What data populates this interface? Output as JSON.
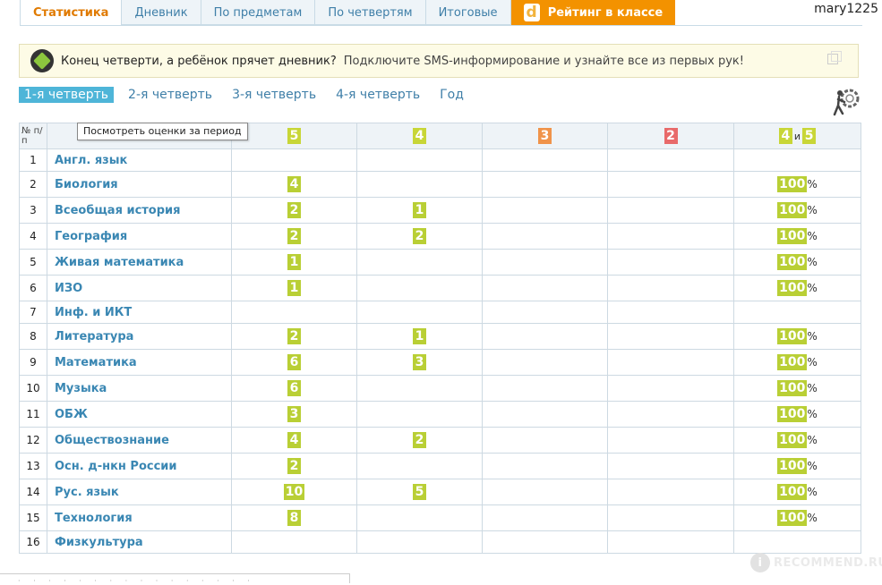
{
  "tabs": [
    {
      "label": "Статистика",
      "active": true
    },
    {
      "label": "Дневник"
    },
    {
      "label": "По предметам"
    },
    {
      "label": "По четвертям"
    },
    {
      "label": "Итоговые"
    },
    {
      "label": "Рейтинг в классе",
      "logo": "d"
    }
  ],
  "user": {
    "name": "mary1225"
  },
  "banner": {
    "strong": "Конец четверти, а ребёнок прячет дневник?",
    "text": "Подключите SMS-информирование и узнайте все из первых рук!"
  },
  "periods": [
    "1-я четверть",
    "2-я четверть",
    "3-я четверть",
    "4-я четверть",
    "Год"
  ],
  "active_period": 0,
  "tooltip": "Посмотреть оценки за период",
  "table": {
    "num_header": "№ п/п",
    "grade_headers": [
      "5",
      "4",
      "3",
      "2"
    ],
    "combo_header": {
      "a": "4",
      "and": "и",
      "b": "5"
    },
    "rows": [
      {
        "n": "1",
        "subject": "Англ. язык",
        "g5": "",
        "g4": "",
        "g3": "",
        "g2": "",
        "pct": ""
      },
      {
        "n": "2",
        "subject": "Биология",
        "g5": "4",
        "g4": "",
        "g3": "",
        "g2": "",
        "pct": "100"
      },
      {
        "n": "3",
        "subject": "Всеобщая история",
        "g5": "2",
        "g4": "1",
        "g3": "",
        "g2": "",
        "pct": "100"
      },
      {
        "n": "4",
        "subject": "География",
        "g5": "2",
        "g4": "2",
        "g3": "",
        "g2": "",
        "pct": "100"
      },
      {
        "n": "5",
        "subject": "Живая математика",
        "g5": "1",
        "g4": "",
        "g3": "",
        "g2": "",
        "pct": "100"
      },
      {
        "n": "6",
        "subject": "ИЗО",
        "g5": "1",
        "g4": "",
        "g3": "",
        "g2": "",
        "pct": "100"
      },
      {
        "n": "7",
        "subject": "Инф. и ИКТ",
        "g5": "",
        "g4": "",
        "g3": "",
        "g2": "",
        "pct": ""
      },
      {
        "n": "8",
        "subject": "Литература",
        "g5": "2",
        "g4": "1",
        "g3": "",
        "g2": "",
        "pct": "100"
      },
      {
        "n": "9",
        "subject": "Математика",
        "g5": "6",
        "g4": "3",
        "g3": "",
        "g2": "",
        "pct": "100"
      },
      {
        "n": "10",
        "subject": "Музыка",
        "g5": "6",
        "g4": "",
        "g3": "",
        "g2": "",
        "pct": "100"
      },
      {
        "n": "11",
        "subject": "ОБЖ",
        "g5": "3",
        "g4": "",
        "g3": "",
        "g2": "",
        "pct": "100"
      },
      {
        "n": "12",
        "subject": "Обществознание",
        "g5": "4",
        "g4": "2",
        "g3": "",
        "g2": "",
        "pct": "100"
      },
      {
        "n": "13",
        "subject": "Осн. д-нкн России",
        "g5": "2",
        "g4": "",
        "g3": "",
        "g2": "",
        "pct": "100"
      },
      {
        "n": "14",
        "subject": "Рус. язык",
        "g5": "10",
        "g4": "5",
        "g3": "",
        "g2": "",
        "pct": "100"
      },
      {
        "n": "15",
        "subject": "Технология",
        "g5": "8",
        "g4": "",
        "g3": "",
        "g2": "",
        "pct": "100"
      },
      {
        "n": "16",
        "subject": "Физкультура",
        "g5": "",
        "g4": "",
        "g3": "",
        "g2": "",
        "pct": ""
      }
    ],
    "pct_sign": "%"
  },
  "watermark": {
    "text": "RECOMMEND.RU",
    "badge": "i"
  },
  "colors": {
    "accent_orange": "#f39200",
    "link_blue": "#3f7fa8",
    "grade_green": "#b9cf35",
    "grade_orange": "#f0934a",
    "grade_red": "#e86a6a",
    "period_active": "#4eb5d8"
  }
}
